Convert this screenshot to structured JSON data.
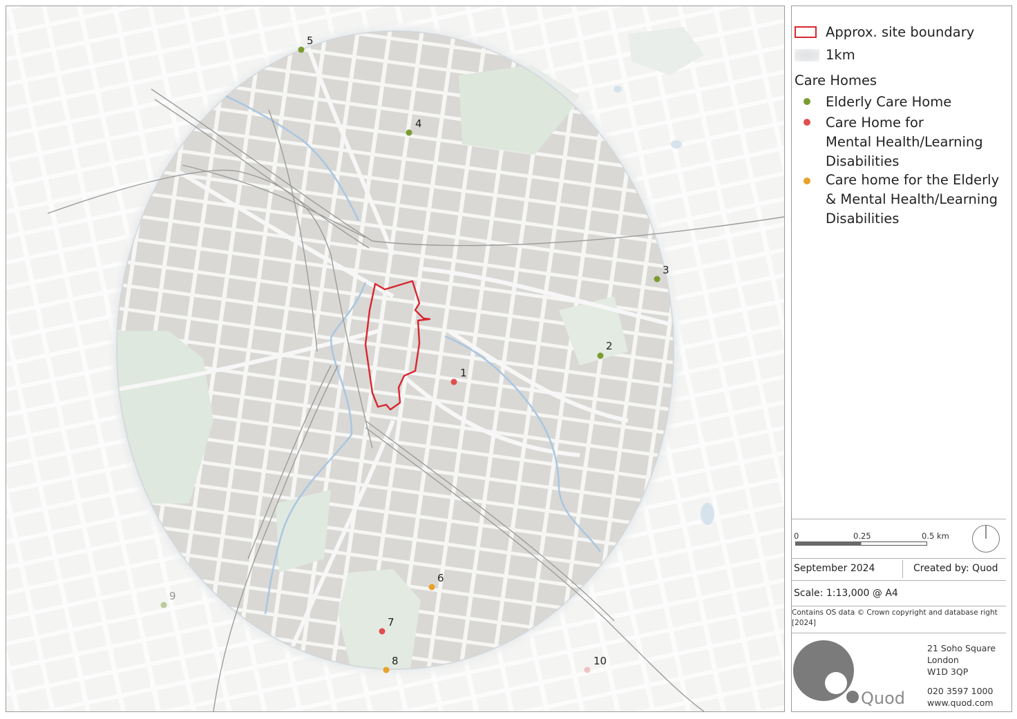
{
  "legend": {
    "site_boundary": "Approx. site boundary",
    "buffer": "1km",
    "group_title": "Care Homes",
    "categories": [
      {
        "label_lines": [
          "Elderly Care Home"
        ],
        "color": "#7a9b2e"
      },
      {
        "label_lines": [
          "Care Home for",
          "Mental Health/Learning",
          "Disabilities"
        ],
        "color": "#e04f4f"
      },
      {
        "label_lines": [
          "Care home for the Elderly",
          "& Mental Health/Learning",
          "Disabilities"
        ],
        "color": "#e9a22a"
      }
    ]
  },
  "scalebar": {
    "tick0": "0",
    "tick1": "0.25",
    "tick2": "0.5 km"
  },
  "date": "September 2024",
  "created_by": "Created by: Quod",
  "scale": "Scale: 1:13,000 @ A4",
  "copyright": [
    "Contains OS data © Crown copyright and database right",
    "[2024]"
  ],
  "address": [
    "21 Soho Square",
    "London",
    "W1D 3QP"
  ],
  "phone": "020 3597 1000",
  "website": "www.quod.com",
  "logo_text": "Quod",
  "markers": [
    {
      "id": "1",
      "category": 1,
      "inside": true
    },
    {
      "id": "2",
      "category": 0,
      "inside": true
    },
    {
      "id": "3",
      "category": 0,
      "inside": true
    },
    {
      "id": "4",
      "category": 0,
      "inside": true
    },
    {
      "id": "5",
      "category": 0,
      "inside": true
    },
    {
      "id": "6",
      "category": 2,
      "inside": true
    },
    {
      "id": "7",
      "category": 1,
      "inside": true
    },
    {
      "id": "8",
      "category": 2,
      "inside": true
    },
    {
      "id": "9",
      "category": 0,
      "inside": false
    },
    {
      "id": "10",
      "category": 1,
      "inside": false
    }
  ]
}
